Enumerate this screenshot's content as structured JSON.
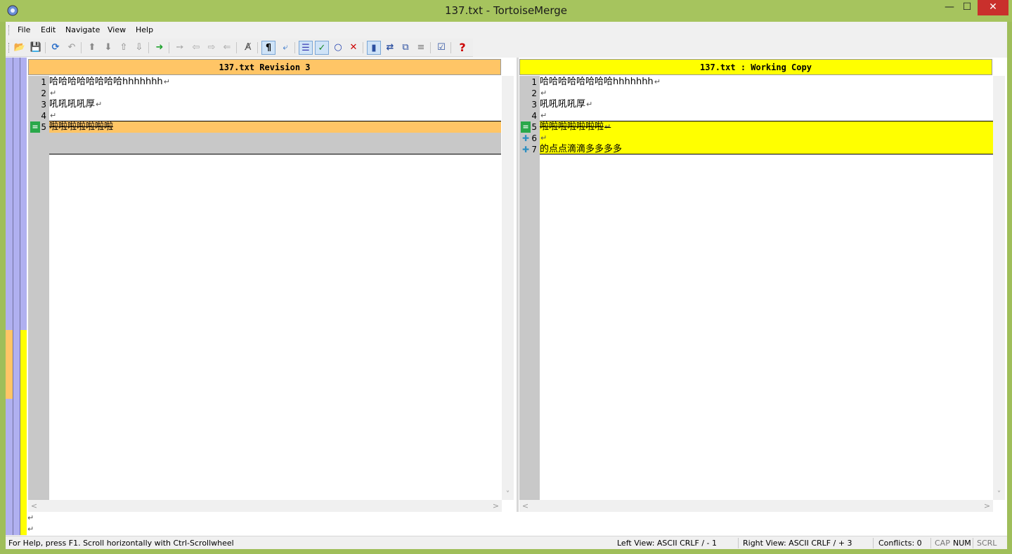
{
  "window": {
    "title": "137.txt - TortoiseMerge",
    "controls": {
      "minimize": "—",
      "maximize": "☐",
      "close": "✕"
    }
  },
  "menu": [
    "File",
    "Edit",
    "Navigate",
    "View",
    "Help"
  ],
  "toolbar": {
    "icons": [
      {
        "name": "open-icon",
        "glyph": "📂"
      },
      {
        "name": "save-icon",
        "glyph": "💾"
      },
      {
        "name": "reload-icon",
        "glyph": "⟳"
      },
      {
        "name": "undo-icon",
        "glyph": "↶"
      },
      {
        "name": "prev-difference-icon",
        "glyph": "⬆"
      },
      {
        "name": "next-difference-icon",
        "glyph": "⬇"
      },
      {
        "name": "prev-conflict-icon",
        "glyph": "⇧"
      },
      {
        "name": "next-conflict-icon",
        "glyph": "⇩"
      },
      {
        "name": "goto-icon",
        "glyph": "➜"
      },
      {
        "name": "use-block-icon",
        "glyph": "➙"
      },
      {
        "name": "use-left-icon",
        "glyph": "⇦"
      },
      {
        "name": "use-right-icon",
        "glyph": "⇨"
      },
      {
        "name": "use-other-icon",
        "glyph": "⇐"
      },
      {
        "name": "spellcheck-icon",
        "glyph": "A̸"
      },
      {
        "name": "whitespace-icon",
        "glyph": "¶"
      },
      {
        "name": "wrap-icon",
        "glyph": "⤶"
      },
      {
        "name": "inline-diff-icon",
        "glyph": "☰"
      },
      {
        "name": "mark-resolved-icon",
        "glyph": "✓"
      },
      {
        "name": "circle-icon",
        "glyph": "○"
      },
      {
        "name": "discard-icon",
        "glyph": "✕"
      },
      {
        "name": "one-pane-icon",
        "glyph": "▮"
      },
      {
        "name": "two-pane-icon",
        "glyph": "⇄"
      },
      {
        "name": "three-pane-icon",
        "glyph": "⧉"
      },
      {
        "name": "list-icon",
        "glyph": "≡"
      },
      {
        "name": "settings-icon",
        "glyph": "☑"
      },
      {
        "name": "help-icon",
        "glyph": "?"
      }
    ]
  },
  "left_pane": {
    "header": "137.txt Revision 3",
    "lines": [
      {
        "num": "1",
        "text": "哈哈哈哈哈哈哈哈hhhhhhh",
        "crlf": "↵"
      },
      {
        "num": "2",
        "text": "",
        "crlf": "↵"
      },
      {
        "num": "3",
        "text": "吼吼吼吼厚",
        "crlf": "↵"
      },
      {
        "num": "4",
        "text": "",
        "crlf": "↵"
      },
      {
        "num": "5",
        "text": "啦啦啦啦啦啦啦",
        "crlf": ""
      }
    ],
    "marker": "="
  },
  "right_pane": {
    "header": "137.txt : Working Copy",
    "lines": [
      {
        "num": "1",
        "text": "哈哈哈哈哈哈哈哈hhhhhhh",
        "crlf": "↵"
      },
      {
        "num": "2",
        "text": "",
        "crlf": "↵"
      },
      {
        "num": "3",
        "text": "吼吼吼吼厚",
        "crlf": "↵"
      },
      {
        "num": "4",
        "text": "",
        "crlf": "↵"
      },
      {
        "num": "5",
        "text": "啦啦啦啦啦啦啦",
        "crlf": "↵"
      },
      {
        "num": "6",
        "text": "",
        "crlf": "↵"
      },
      {
        "num": "7",
        "text": "的点点滴滴多多多多",
        "crlf": ""
      }
    ],
    "markers": {
      "changed": "=",
      "added": "✚"
    }
  },
  "bottom_pane": {
    "lines": [
      "↵",
      "↵"
    ]
  },
  "scroll": {
    "up": "˄",
    "down": "˅",
    "left": "<",
    "right": ">"
  },
  "status": {
    "help": "For Help, press F1. Scroll horizontally with Ctrl-Scrollwheel",
    "left_view": "Left View: ASCII CRLF  / - 1",
    "right_view": "Right View: ASCII CRLF  / + 3",
    "conflicts": "Conflicts: 0",
    "cap": "CAP",
    "num": "NUM",
    "scrl": "SCRL"
  },
  "colors": {
    "left_header": "#ffc566",
    "right_header": "#ffff00",
    "removed": "#ffc566",
    "added": "#ffff00",
    "empty": "#c8c8c8",
    "locator": "#b0b0f0"
  }
}
